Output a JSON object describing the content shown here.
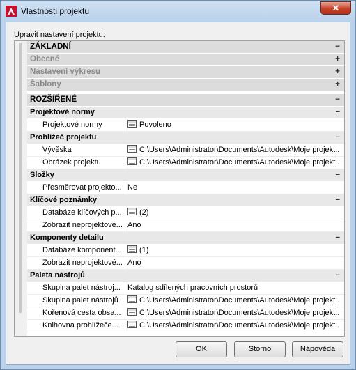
{
  "window": {
    "title": "Vlastnosti projektu",
    "close_label": "✕"
  },
  "prompt": "Upravit nastavení projektu:",
  "grid": {
    "rows": [
      {
        "kind": "cat",
        "label": "ZÁKLADNÍ",
        "toggle": "−"
      },
      {
        "kind": "cat",
        "label": "Obecné",
        "toggle": "+",
        "disabled": true
      },
      {
        "kind": "cat",
        "label": "Nastavení výkresu",
        "toggle": "+",
        "disabled": true
      },
      {
        "kind": "cat",
        "label": "Šablony",
        "toggle": "+",
        "disabled": true
      },
      {
        "kind": "cat",
        "label": "ROZŠÍŘENÉ",
        "toggle": "−"
      },
      {
        "kind": "sub",
        "label": "Projektové normy",
        "toggle": "−"
      },
      {
        "kind": "prop",
        "name": "Projektové normy",
        "value": "Povoleno",
        "icon": true
      },
      {
        "kind": "sub",
        "label": "Prohlížeč projektu",
        "toggle": "−"
      },
      {
        "kind": "prop",
        "name": "Vývěska",
        "value": "C:\\Users\\Administrator\\Documents\\Autodesk\\Moje projekt...",
        "icon": true
      },
      {
        "kind": "prop",
        "name": "Obrázek projektu",
        "value": "C:\\Users\\Administrator\\Documents\\Autodesk\\Moje projekt...",
        "icon": true
      },
      {
        "kind": "sub",
        "label": "Složky",
        "toggle": "−"
      },
      {
        "kind": "prop",
        "name": "Přesměrovat projekto...",
        "value": "Ne",
        "icon": false
      },
      {
        "kind": "sub",
        "label": "Klíčové poznámky",
        "toggle": "−"
      },
      {
        "kind": "prop",
        "name": "Databáze klíčových p...",
        "value": "(2)",
        "icon": true
      },
      {
        "kind": "prop",
        "name": "Zobrazit neprojektové...",
        "value": "Ano",
        "icon": false
      },
      {
        "kind": "sub",
        "label": "Komponenty detailu",
        "toggle": "−"
      },
      {
        "kind": "prop",
        "name": "Databáze komponent...",
        "value": "(1)",
        "icon": true
      },
      {
        "kind": "prop",
        "name": "Zobrazit neprojektové...",
        "value": "Ano",
        "icon": false
      },
      {
        "kind": "sub",
        "label": "Paleta nástrojů",
        "toggle": "−"
      },
      {
        "kind": "prop",
        "name": "Skupina palet nástroj...",
        "value": "Katalog sdílených pracovních prostorů",
        "icon": false
      },
      {
        "kind": "prop",
        "name": "Skupina palet nástrojů",
        "value": "C:\\Users\\Administrator\\Documents\\Autodesk\\Moje projekt...",
        "icon": true
      },
      {
        "kind": "prop",
        "name": "Kořenová cesta obsa...",
        "value": "C:\\Users\\Administrator\\Documents\\Autodesk\\Moje projekt...",
        "icon": true
      },
      {
        "kind": "prop",
        "name": "Knihovna prohlížeče...",
        "value": "C:\\Users\\Administrator\\Documents\\Autodesk\\Moje projekt...",
        "icon": true
      }
    ]
  },
  "buttons": {
    "ok": "OK",
    "cancel": "Storno",
    "help": "Nápověda"
  },
  "colors": {
    "app_icon_red": "#c8102e",
    "close_red": "#c7402a"
  }
}
